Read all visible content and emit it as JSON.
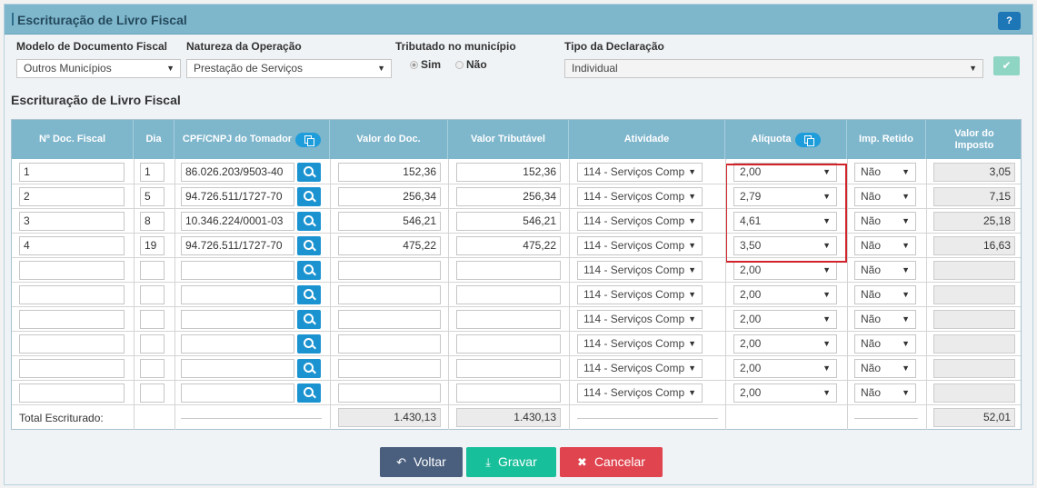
{
  "window": {
    "title": "Escrituração de Livro Fiscal",
    "help_label": "?"
  },
  "form": {
    "modelo_label": "Modelo de Documento Fiscal",
    "modelo_value": "Outros Municípios",
    "natureza_label": "Natureza da Operação",
    "natureza_value": "Prestação de Serviços",
    "tributado_label": "Tributado no município",
    "tributado_options": [
      "Sim",
      "Não"
    ],
    "tributado_selected": "Sim",
    "tipo_label": "Tipo da Declaração",
    "tipo_value": "Individual"
  },
  "section_title": "Escrituração de Livro Fiscal",
  "table": {
    "headers": {
      "doc": "Nº Doc. Fiscal",
      "dia": "Dia",
      "cpf": "CPF/CNPJ do Tomador",
      "valor_doc": "Valor do Doc.",
      "valor_trib": "Valor Tributável",
      "atividade": "Atividade",
      "aliquota": "Alíquota",
      "imp_retido": "Imp. Retido",
      "valor_imposto": "Valor do Imposto"
    },
    "rows": [
      {
        "doc": "1",
        "dia": "1",
        "cpf": "86.026.203/9503-40",
        "valor_doc": "152,36",
        "valor_trib": "152,36",
        "atividade": "114 - Serviços Comp",
        "aliquota": "2,00",
        "imp_retido": "Não",
        "valor_imposto": "3,05"
      },
      {
        "doc": "2",
        "dia": "5",
        "cpf": "94.726.511/1727-70",
        "valor_doc": "256,34",
        "valor_trib": "256,34",
        "atividade": "114 - Serviços Comp",
        "aliquota": "2,79",
        "imp_retido": "Não",
        "valor_imposto": "7,15"
      },
      {
        "doc": "3",
        "dia": "8",
        "cpf": "10.346.224/0001-03",
        "valor_doc": "546,21",
        "valor_trib": "546,21",
        "atividade": "114 - Serviços Comp",
        "aliquota": "4,61",
        "imp_retido": "Não",
        "valor_imposto": "25,18"
      },
      {
        "doc": "4",
        "dia": "19",
        "cpf": "94.726.511/1727-70",
        "valor_doc": "475,22",
        "valor_trib": "475,22",
        "atividade": "114 - Serviços Comp",
        "aliquota": "3,50",
        "imp_retido": "Não",
        "valor_imposto": "16,63"
      },
      {
        "doc": "",
        "dia": "",
        "cpf": "",
        "valor_doc": "",
        "valor_trib": "",
        "atividade": "114 - Serviços Comp",
        "aliquota": "2,00",
        "imp_retido": "Não",
        "valor_imposto": ""
      },
      {
        "doc": "",
        "dia": "",
        "cpf": "",
        "valor_doc": "",
        "valor_trib": "",
        "atividade": "114 - Serviços Comp",
        "aliquota": "2,00",
        "imp_retido": "Não",
        "valor_imposto": ""
      },
      {
        "doc": "",
        "dia": "",
        "cpf": "",
        "valor_doc": "",
        "valor_trib": "",
        "atividade": "114 - Serviços Comp",
        "aliquota": "2,00",
        "imp_retido": "Não",
        "valor_imposto": ""
      },
      {
        "doc": "",
        "dia": "",
        "cpf": "",
        "valor_doc": "",
        "valor_trib": "",
        "atividade": "114 - Serviços Comp",
        "aliquota": "2,00",
        "imp_retido": "Não",
        "valor_imposto": ""
      },
      {
        "doc": "",
        "dia": "",
        "cpf": "",
        "valor_doc": "",
        "valor_trib": "",
        "atividade": "114 - Serviços Comp",
        "aliquota": "2,00",
        "imp_retido": "Não",
        "valor_imposto": ""
      },
      {
        "doc": "",
        "dia": "",
        "cpf": "",
        "valor_doc": "",
        "valor_trib": "",
        "atividade": "114 - Serviços Comp",
        "aliquota": "2,00",
        "imp_retido": "Não",
        "valor_imposto": ""
      }
    ],
    "totals": {
      "label": "Total Escriturado:",
      "valor_doc": "1.430,13",
      "valor_trib": "1.430,13",
      "valor_imposto": "52,01"
    }
  },
  "buttons": {
    "back": "Voltar",
    "save": "Gravar",
    "cancel": "Cancelar"
  },
  "colors": {
    "header": "#7eb6cc",
    "accent": "#1b93d1",
    "save": "#18bf9b",
    "cancel": "#e0444f",
    "back": "#4a5f7e",
    "highlight": "#d2232a"
  }
}
